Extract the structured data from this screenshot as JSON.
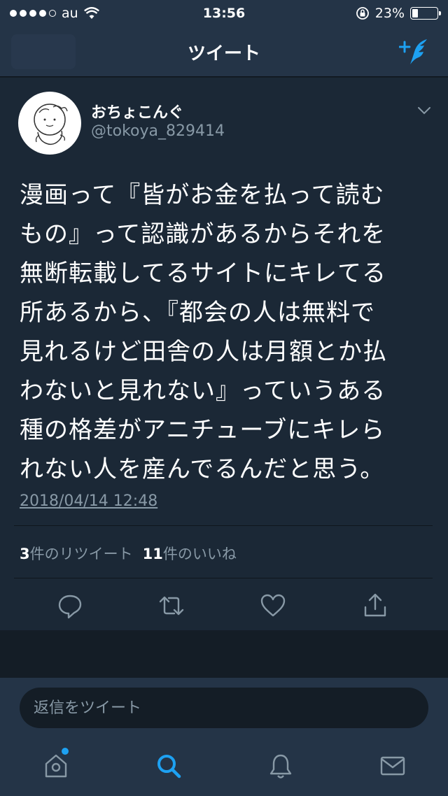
{
  "status_bar": {
    "carrier": "au",
    "time": "13:56",
    "battery_percent": "23%",
    "battery_level": 0.23,
    "signal_bars": 4
  },
  "nav": {
    "title": "ツイート"
  },
  "tweet": {
    "display_name": "おちょこんぐ",
    "handle": "@tokoya_829414",
    "text": "漫画って『皆がお金を払って読む\nもの』って認識があるからそれを\n無断転載してるサイトにキレてる\n所あるから、『都会の人は無料で\n見れるけど田舎の人は月額とか払\nわないと見れない』っていうある\n種の格差がアニチューブにキレら\nれない人を産んでるんだと思う。",
    "timestamp": "2018/04/14 12:48",
    "retweet_count": "3",
    "retweet_label": "件のリツイート",
    "like_count": "11",
    "like_label": "件のいいね"
  },
  "reply": {
    "placeholder": "返信をツイート"
  },
  "colors": {
    "accent": "#1da1f2",
    "bar_bg": "#243447",
    "card_bg": "#1b2836",
    "page_bg": "#141d26",
    "muted": "#8899a6"
  },
  "icons": {
    "compose": "compose-tweet-icon",
    "reply": "reply-icon",
    "retweet": "retweet-icon",
    "like": "heart-icon",
    "share": "share-icon",
    "home": "home-icon",
    "search": "search-icon",
    "notifications": "bell-icon",
    "messages": "mail-icon"
  }
}
